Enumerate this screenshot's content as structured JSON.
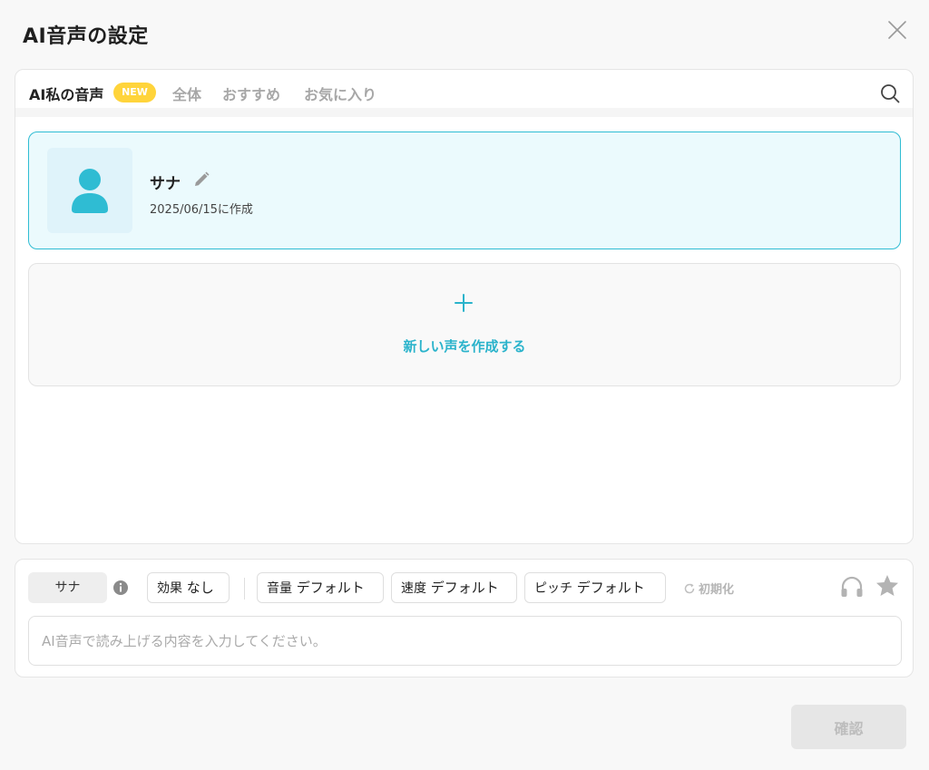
{
  "dialog": {
    "title": "AI音声の設定"
  },
  "tabs": {
    "my_voice": "AI私の音声",
    "new_badge": "NEW",
    "all": "全体",
    "recommended": "おすすめ",
    "favorites": "お気に入り"
  },
  "voice_card": {
    "name": "サナ",
    "created": "2025/06/15に作成"
  },
  "create_card": {
    "label": "新しい声を作成する"
  },
  "controls": {
    "voice_chip": "サナ",
    "effect_key": "効果",
    "effect_value": "なし",
    "volume_key": "音量",
    "volume_value": "デフォルト",
    "speed_key": "速度",
    "speed_value": "デフォルト",
    "pitch_key": "ピッチ",
    "pitch_value": "デフォルト",
    "reset_label": "初期化",
    "input_placeholder": "AI音声で読み上げる内容を入力してください。",
    "input_value": ""
  },
  "footer": {
    "confirm_label": "確認"
  },
  "colors": {
    "accent": "#2fbcd3",
    "badge": "#ffd43b",
    "card_bg": "#ebfafd"
  },
  "icons": {
    "close": "close-icon",
    "search": "search-icon",
    "avatar": "person-icon",
    "edit": "pencil-icon",
    "add": "plus-icon",
    "info": "info-icon",
    "reset": "refresh-icon",
    "listen": "headphone-icon",
    "favorite": "star-icon"
  }
}
